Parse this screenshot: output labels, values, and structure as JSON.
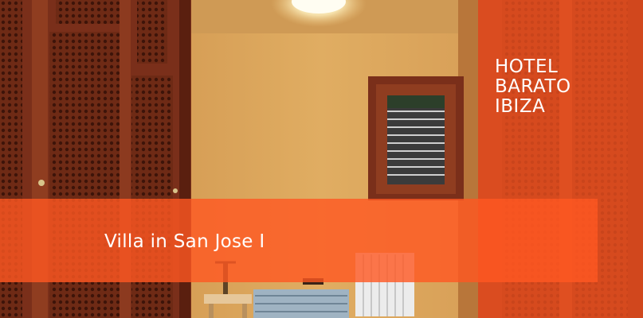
{
  "brand": {
    "line1": "HOTEL",
    "line2": "BARATO",
    "line3": "IBIZA"
  },
  "caption": {
    "title": "Villa in San Jose I"
  },
  "photo": {
    "subject": "hotel room",
    "elements": [
      "wardrobe-doors",
      "window",
      "radiator",
      "bed",
      "bedside-table",
      "ceiling-lamp"
    ]
  },
  "colors": {
    "overlay": "#ff5722",
    "wall": "#d9a35a",
    "wood": "#7a2f1a",
    "text": "#ffffff"
  }
}
